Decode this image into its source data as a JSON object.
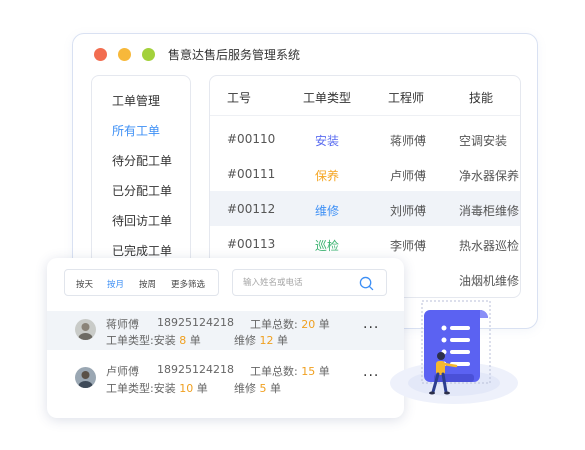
{
  "window": {
    "title": "售意达售后服务管理系统",
    "dot_colors": [
      "#f26d50",
      "#f7b83a",
      "#a3d13c"
    ]
  },
  "sidebar": {
    "items": [
      {
        "label": "工单管理",
        "active": false
      },
      {
        "label": "所有工单",
        "active": true
      },
      {
        "label": "待分配工单",
        "active": false
      },
      {
        "label": "已分配工单",
        "active": false
      },
      {
        "label": "待回访工单",
        "active": false
      },
      {
        "label": "已完成工单",
        "active": false
      }
    ]
  },
  "table": {
    "headers": [
      "工号",
      "工程师",
      "工单类型",
      "技能"
    ],
    "rows": [
      {
        "id": "#00110",
        "type": "安装",
        "type_color": "#5a6cf0",
        "engineer": "蒋师傅",
        "skill": "空调安装"
      },
      {
        "id": "#00111",
        "type": "保养",
        "type_color": "#f5a623",
        "engineer": "卢师傅",
        "skill": "净水器保养"
      },
      {
        "id": "#00112",
        "type": "维修",
        "type_color": "#3d8ff5",
        "engineer": "刘师傅",
        "skill": "消毒柜维修"
      },
      {
        "id": "#00113",
        "type": "巡检",
        "type_color": "#3cb371",
        "engineer": "李师傅",
        "skill": "热水器巡检"
      },
      {
        "id": "",
        "type": "",
        "type_color": "#333333",
        "engineer": "",
        "skill": "油烟机维修"
      }
    ]
  },
  "filters": {
    "buttons": [
      "按天",
      "按月",
      "按周",
      "更多筛选"
    ],
    "active_index": 1,
    "active_color": "#3d8ff5"
  },
  "search": {
    "placeholder": "输入姓名或电话",
    "icon": "search-icon"
  },
  "engineers": [
    {
      "name": "蒋师傅",
      "phone": "18925124218",
      "total_label": "工单总数:",
      "total": "20",
      "unit": "单",
      "type_label": "工单类型:",
      "install_label": "安装",
      "install": "8",
      "repair_label": "维修",
      "repair": "12",
      "more": "···"
    },
    {
      "name": "卢师傅",
      "phone": "18925124218",
      "total_label": "工单总数:",
      "total": "15",
      "unit": "单",
      "type_label": "工单类型:",
      "install_label": "安装",
      "install": "10",
      "repair_label": "维修",
      "repair": "5",
      "more": "···"
    }
  ]
}
